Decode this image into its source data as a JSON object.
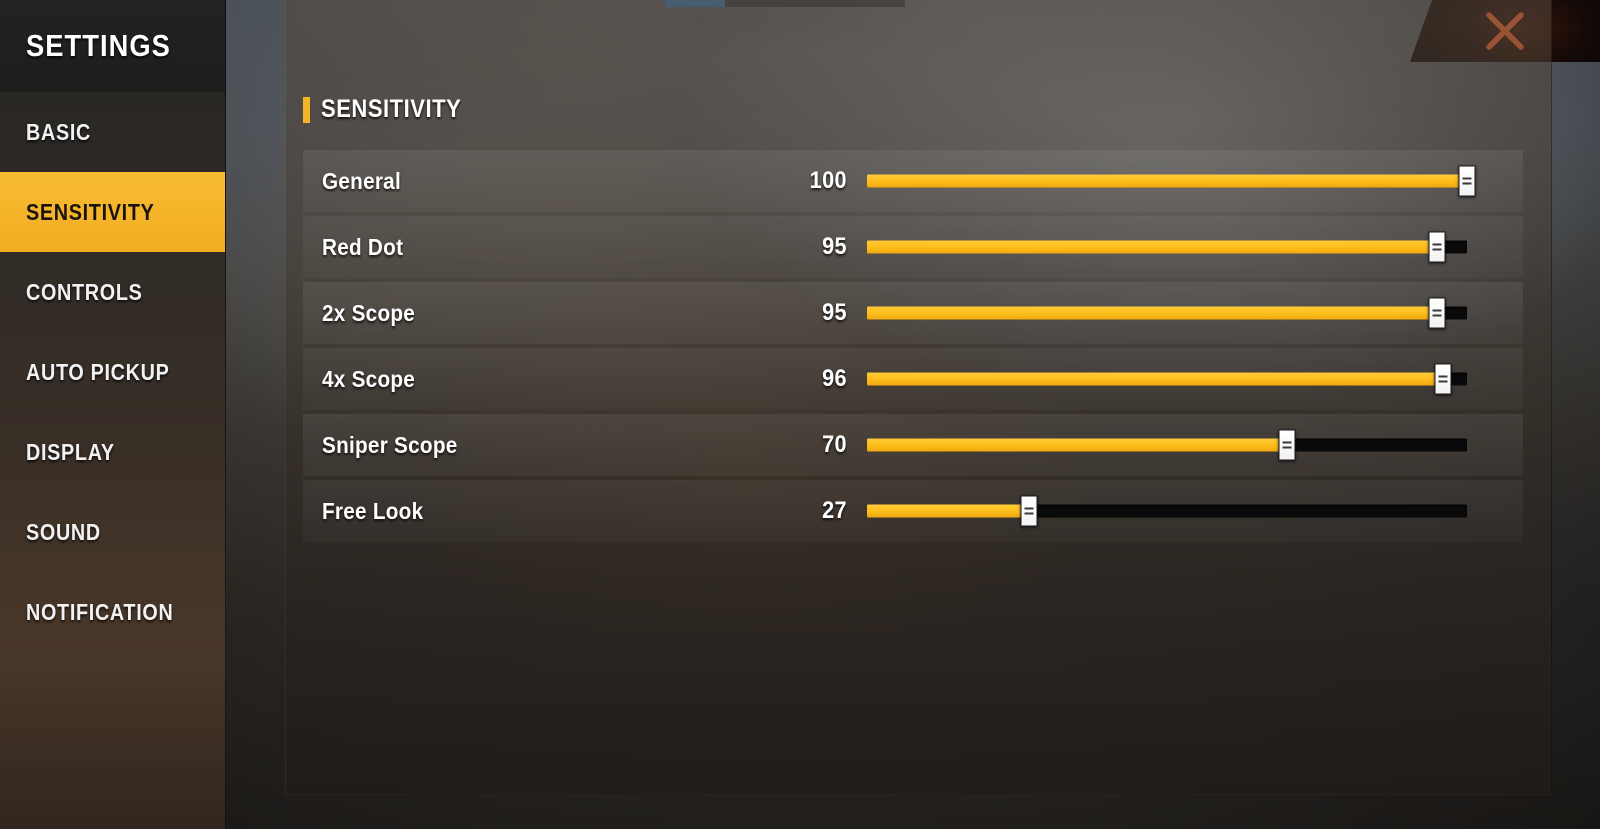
{
  "sidebar": {
    "title": "SETTINGS",
    "items": [
      {
        "label": "BASIC",
        "active": false
      },
      {
        "label": "SENSITIVITY",
        "active": true
      },
      {
        "label": "CONTROLS",
        "active": false
      },
      {
        "label": "AUTO PICKUP",
        "active": false
      },
      {
        "label": "DISPLAY",
        "active": false
      },
      {
        "label": "SOUND",
        "active": false
      },
      {
        "label": "NOTIFICATION",
        "active": false
      }
    ]
  },
  "close_button": {
    "icon": "close-x-icon"
  },
  "main": {
    "section_title": "SENSITIVITY",
    "slider_min": 0,
    "slider_max": 100,
    "rows": [
      {
        "label": "General",
        "value": "100",
        "percent": 100
      },
      {
        "label": "Red Dot",
        "value": "95",
        "percent": 95
      },
      {
        "label": "2x Scope",
        "value": "95",
        "percent": 95
      },
      {
        "label": "4x Scope",
        "value": "96",
        "percent": 96
      },
      {
        "label": "Sniper Scope",
        "value": "70",
        "percent": 70
      },
      {
        "label": "Free Look",
        "value": "27",
        "percent": 27
      }
    ]
  },
  "colors": {
    "accent_yellow": "#F5B32A",
    "slider_fill": "#FFC01E",
    "highlight_bg": "#F2AD22",
    "close_x": "#E8622E",
    "track_empty": "#0A0A0A",
    "progress_blue": "#2F7FC4"
  }
}
